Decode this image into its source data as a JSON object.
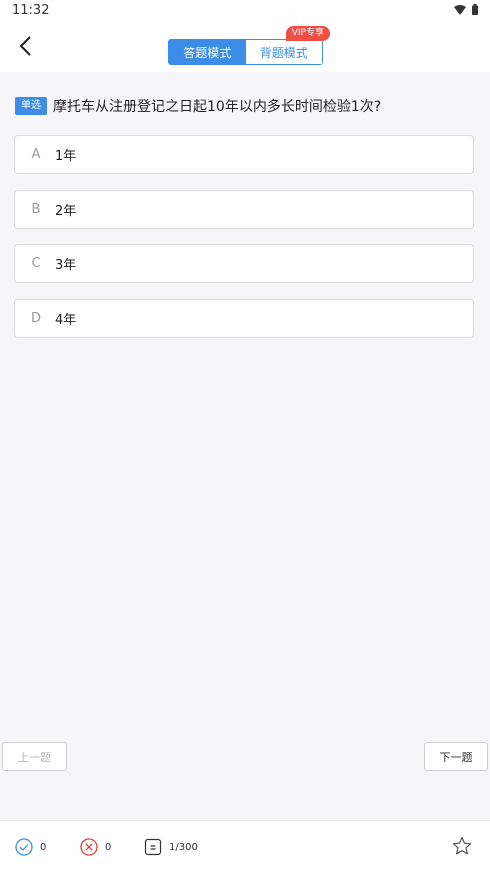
{
  "status_bar": {
    "time": "11:32"
  },
  "mode_switch": {
    "answer_mode": "答题模式",
    "recite_mode": "背题模式",
    "vip_badge": "VIP专享"
  },
  "question": {
    "type_badge": "单选",
    "text": "摩托车从注册登记之日起10年以内多长时间检验1次?"
  },
  "options": [
    {
      "letter": "A",
      "text": "1年"
    },
    {
      "letter": "B",
      "text": "2年"
    },
    {
      "letter": "C",
      "text": "3年"
    },
    {
      "letter": "D",
      "text": "4年"
    }
  ],
  "navigation": {
    "prev": "上一题",
    "next": "下一题"
  },
  "bottom_bar": {
    "correct_count": "0",
    "wrong_count": "0",
    "progress": "1/300"
  },
  "colors": {
    "accent": "#3b8de8",
    "error": "#e23d3d",
    "vip": "#f04d45"
  }
}
